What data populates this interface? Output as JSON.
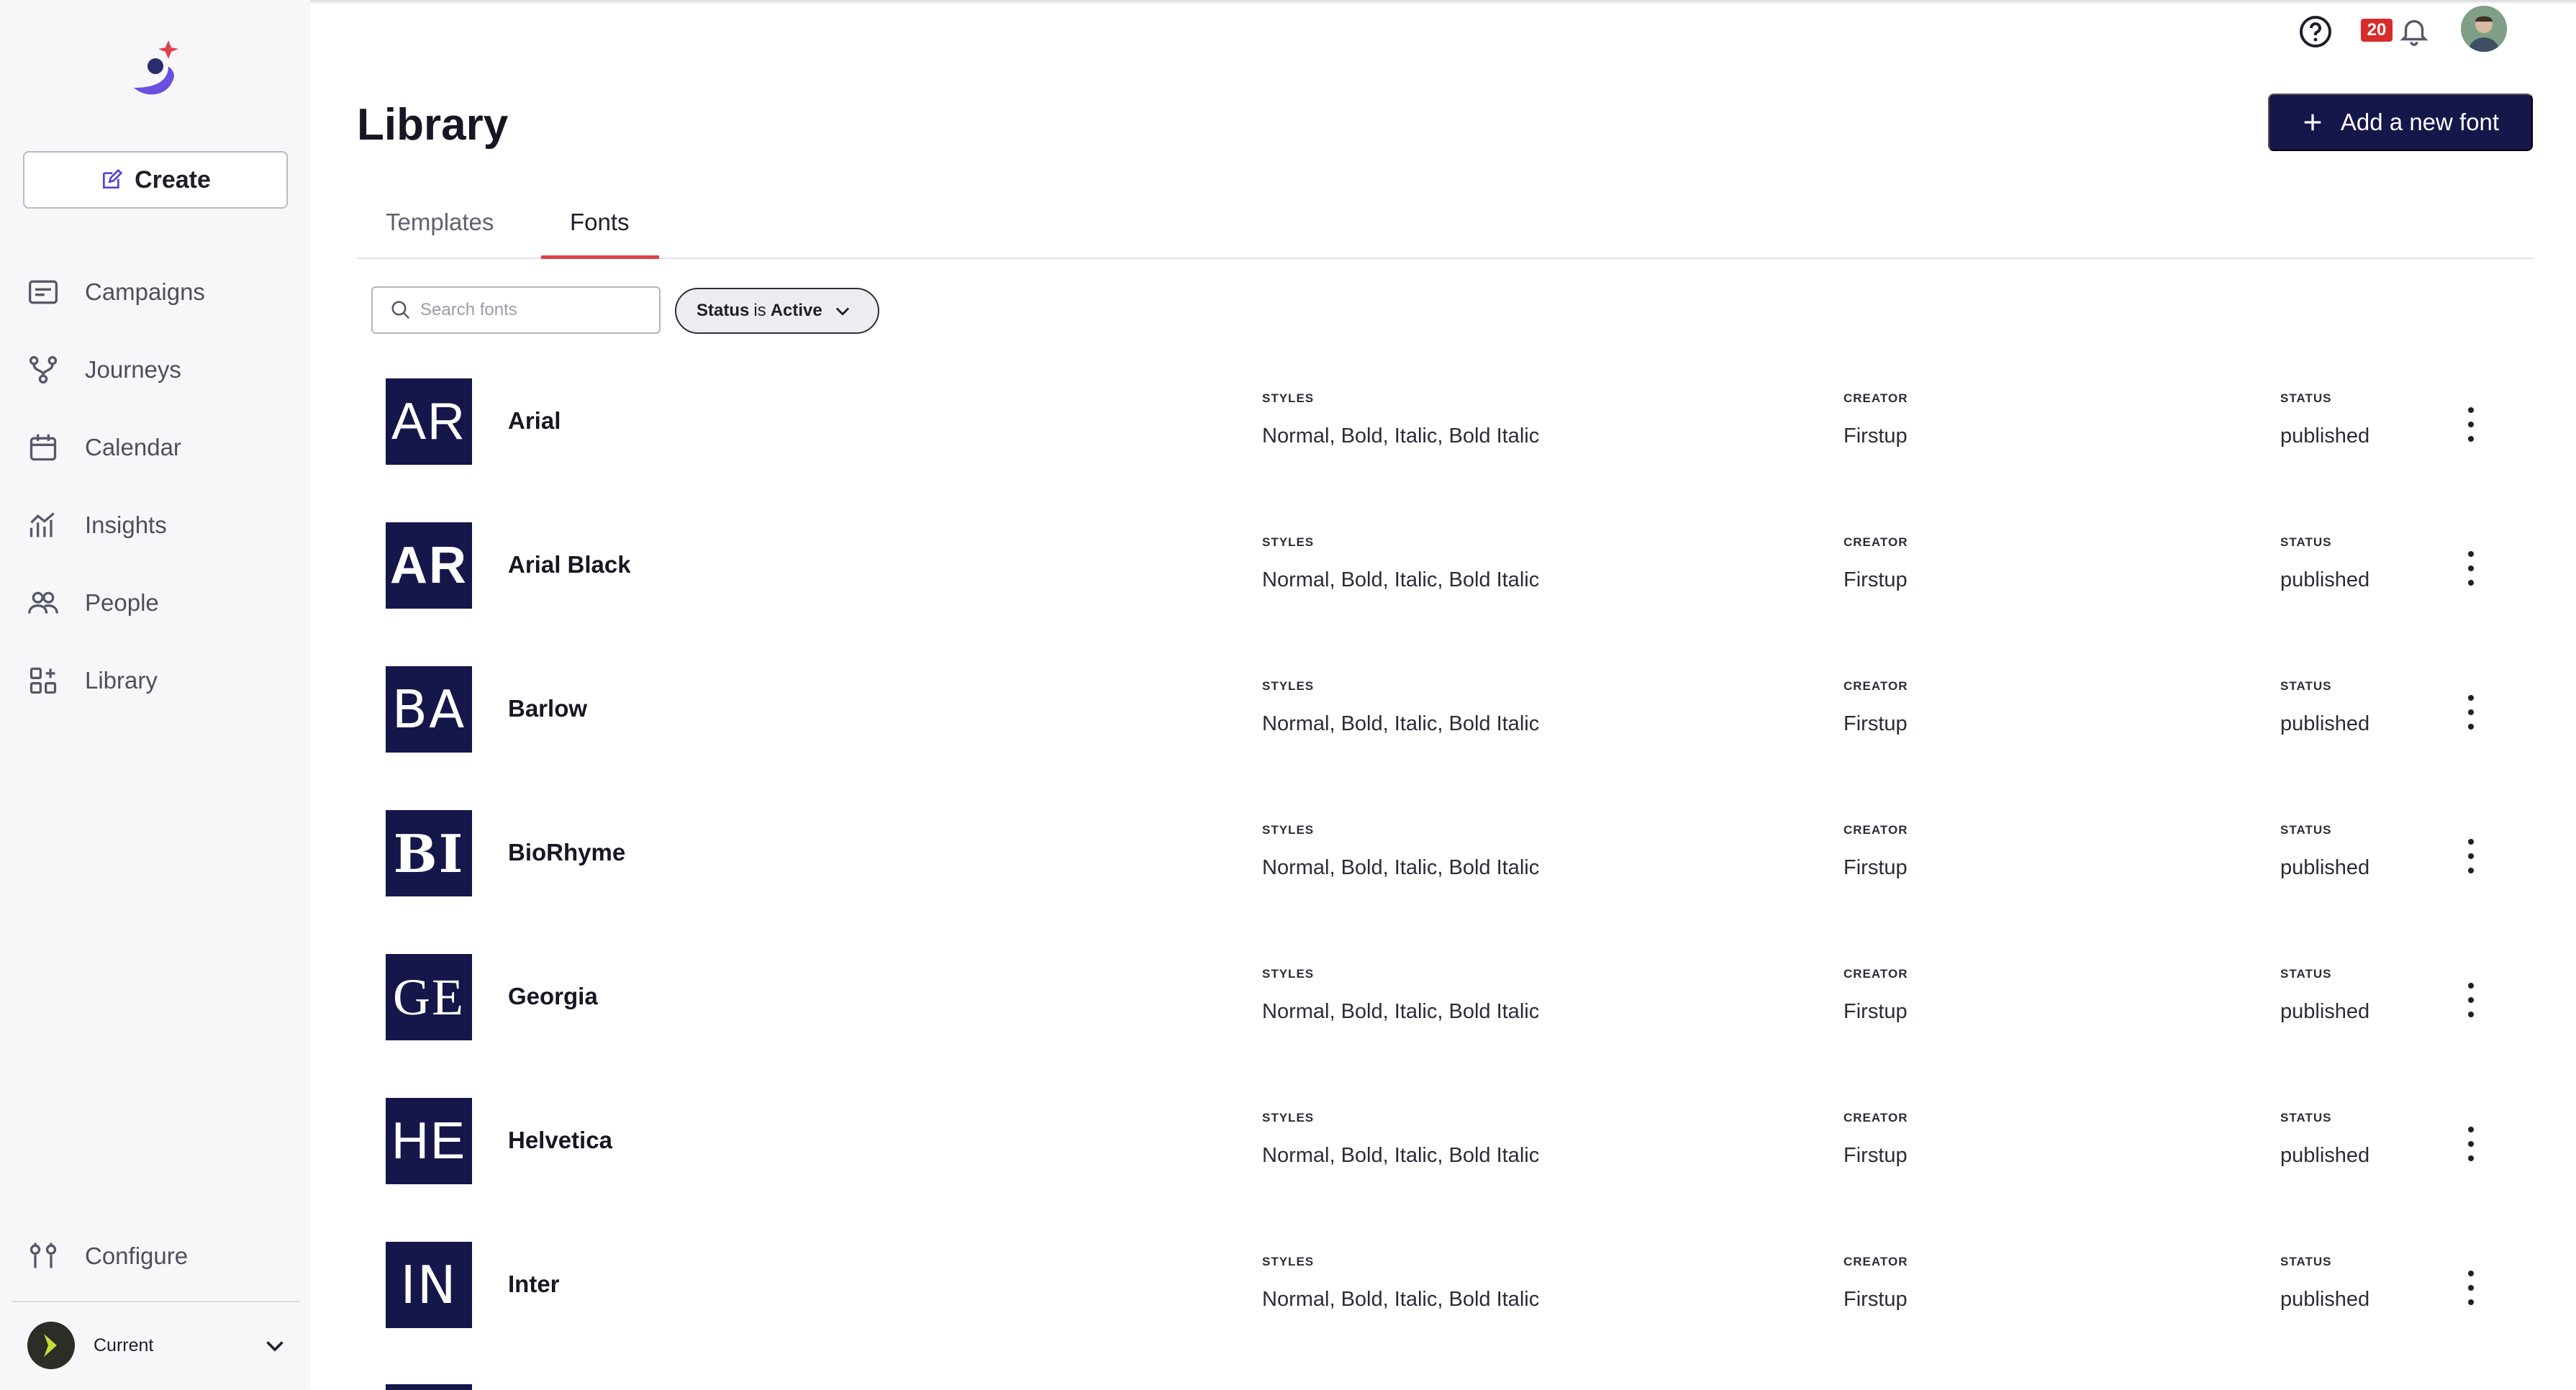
{
  "sidebar": {
    "create_label": "Create",
    "items": [
      {
        "label": "Campaigns",
        "icon": "campaigns-icon"
      },
      {
        "label": "Journeys",
        "icon": "journeys-icon"
      },
      {
        "label": "Calendar",
        "icon": "calendar-icon"
      },
      {
        "label": "Insights",
        "icon": "insights-icon"
      },
      {
        "label": "People",
        "icon": "people-icon"
      },
      {
        "label": "Library",
        "icon": "library-icon"
      }
    ],
    "configure_label": "Configure",
    "account_label": "Current"
  },
  "header": {
    "notification_count": "20"
  },
  "page": {
    "title": "Library",
    "add_button_label": "Add a new font",
    "tabs": [
      {
        "label": "Templates",
        "active": false
      },
      {
        "label": "Fonts",
        "active": true
      }
    ],
    "search_placeholder": "Search fonts",
    "filter": {
      "prefix": "Status",
      "op": "is",
      "value": "Active"
    }
  },
  "columns": {
    "styles": "STYLES",
    "creator": "CREATOR",
    "status": "STATUS"
  },
  "fonts": [
    {
      "abbr": "AR",
      "name": "Arial",
      "styles": "Normal, Bold, Italic, Bold Italic",
      "creator": "Firstup",
      "status": "published"
    },
    {
      "abbr": "AR",
      "name": "Arial Black",
      "styles": "Normal, Bold, Italic, Bold Italic",
      "creator": "Firstup",
      "status": "published"
    },
    {
      "abbr": "BA",
      "name": "Barlow",
      "styles": "Normal, Bold, Italic, Bold Italic",
      "creator": "Firstup",
      "status": "published"
    },
    {
      "abbr": "BI",
      "name": "BioRhyme",
      "styles": "Normal, Bold, Italic, Bold Italic",
      "creator": "Firstup",
      "status": "published"
    },
    {
      "abbr": "GE",
      "name": "Georgia",
      "styles": "Normal, Bold, Italic, Bold Italic",
      "creator": "Firstup",
      "status": "published"
    },
    {
      "abbr": "HE",
      "name": "Helvetica",
      "styles": "Normal, Bold, Italic, Bold Italic",
      "creator": "Firstup",
      "status": "published"
    },
    {
      "abbr": "IN",
      "name": "Inter",
      "styles": "Normal, Bold, Italic, Bold Italic",
      "creator": "Firstup",
      "status": "published"
    }
  ],
  "colors": {
    "navy": "#15164a",
    "accent": "#e0424a",
    "badge": "#d92b2b"
  }
}
